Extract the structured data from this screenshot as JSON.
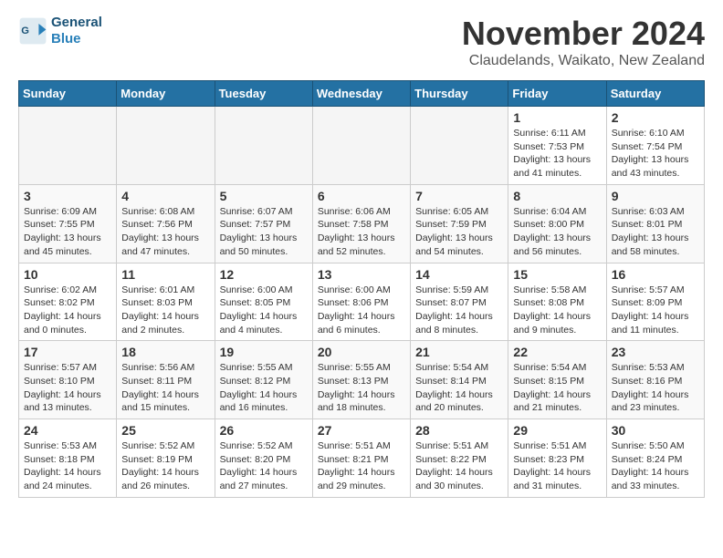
{
  "header": {
    "logo_line1": "General",
    "logo_line2": "Blue",
    "month": "November 2024",
    "location": "Claudelands, Waikato, New Zealand"
  },
  "weekdays": [
    "Sunday",
    "Monday",
    "Tuesday",
    "Wednesday",
    "Thursday",
    "Friday",
    "Saturday"
  ],
  "weeks": [
    [
      {
        "day": "",
        "info": ""
      },
      {
        "day": "",
        "info": ""
      },
      {
        "day": "",
        "info": ""
      },
      {
        "day": "",
        "info": ""
      },
      {
        "day": "",
        "info": ""
      },
      {
        "day": "1",
        "info": "Sunrise: 6:11 AM\nSunset: 7:53 PM\nDaylight: 13 hours\nand 41 minutes."
      },
      {
        "day": "2",
        "info": "Sunrise: 6:10 AM\nSunset: 7:54 PM\nDaylight: 13 hours\nand 43 minutes."
      }
    ],
    [
      {
        "day": "3",
        "info": "Sunrise: 6:09 AM\nSunset: 7:55 PM\nDaylight: 13 hours\nand 45 minutes."
      },
      {
        "day": "4",
        "info": "Sunrise: 6:08 AM\nSunset: 7:56 PM\nDaylight: 13 hours\nand 47 minutes."
      },
      {
        "day": "5",
        "info": "Sunrise: 6:07 AM\nSunset: 7:57 PM\nDaylight: 13 hours\nand 50 minutes."
      },
      {
        "day": "6",
        "info": "Sunrise: 6:06 AM\nSunset: 7:58 PM\nDaylight: 13 hours\nand 52 minutes."
      },
      {
        "day": "7",
        "info": "Sunrise: 6:05 AM\nSunset: 7:59 PM\nDaylight: 13 hours\nand 54 minutes."
      },
      {
        "day": "8",
        "info": "Sunrise: 6:04 AM\nSunset: 8:00 PM\nDaylight: 13 hours\nand 56 minutes."
      },
      {
        "day": "9",
        "info": "Sunrise: 6:03 AM\nSunset: 8:01 PM\nDaylight: 13 hours\nand 58 minutes."
      }
    ],
    [
      {
        "day": "10",
        "info": "Sunrise: 6:02 AM\nSunset: 8:02 PM\nDaylight: 14 hours\nand 0 minutes."
      },
      {
        "day": "11",
        "info": "Sunrise: 6:01 AM\nSunset: 8:03 PM\nDaylight: 14 hours\nand 2 minutes."
      },
      {
        "day": "12",
        "info": "Sunrise: 6:00 AM\nSunset: 8:05 PM\nDaylight: 14 hours\nand 4 minutes."
      },
      {
        "day": "13",
        "info": "Sunrise: 6:00 AM\nSunset: 8:06 PM\nDaylight: 14 hours\nand 6 minutes."
      },
      {
        "day": "14",
        "info": "Sunrise: 5:59 AM\nSunset: 8:07 PM\nDaylight: 14 hours\nand 8 minutes."
      },
      {
        "day": "15",
        "info": "Sunrise: 5:58 AM\nSunset: 8:08 PM\nDaylight: 14 hours\nand 9 minutes."
      },
      {
        "day": "16",
        "info": "Sunrise: 5:57 AM\nSunset: 8:09 PM\nDaylight: 14 hours\nand 11 minutes."
      }
    ],
    [
      {
        "day": "17",
        "info": "Sunrise: 5:57 AM\nSunset: 8:10 PM\nDaylight: 14 hours\nand 13 minutes."
      },
      {
        "day": "18",
        "info": "Sunrise: 5:56 AM\nSunset: 8:11 PM\nDaylight: 14 hours\nand 15 minutes."
      },
      {
        "day": "19",
        "info": "Sunrise: 5:55 AM\nSunset: 8:12 PM\nDaylight: 14 hours\nand 16 minutes."
      },
      {
        "day": "20",
        "info": "Sunrise: 5:55 AM\nSunset: 8:13 PM\nDaylight: 14 hours\nand 18 minutes."
      },
      {
        "day": "21",
        "info": "Sunrise: 5:54 AM\nSunset: 8:14 PM\nDaylight: 14 hours\nand 20 minutes."
      },
      {
        "day": "22",
        "info": "Sunrise: 5:54 AM\nSunset: 8:15 PM\nDaylight: 14 hours\nand 21 minutes."
      },
      {
        "day": "23",
        "info": "Sunrise: 5:53 AM\nSunset: 8:16 PM\nDaylight: 14 hours\nand 23 minutes."
      }
    ],
    [
      {
        "day": "24",
        "info": "Sunrise: 5:53 AM\nSunset: 8:18 PM\nDaylight: 14 hours\nand 24 minutes."
      },
      {
        "day": "25",
        "info": "Sunrise: 5:52 AM\nSunset: 8:19 PM\nDaylight: 14 hours\nand 26 minutes."
      },
      {
        "day": "26",
        "info": "Sunrise: 5:52 AM\nSunset: 8:20 PM\nDaylight: 14 hours\nand 27 minutes."
      },
      {
        "day": "27",
        "info": "Sunrise: 5:51 AM\nSunset: 8:21 PM\nDaylight: 14 hours\nand 29 minutes."
      },
      {
        "day": "28",
        "info": "Sunrise: 5:51 AM\nSunset: 8:22 PM\nDaylight: 14 hours\nand 30 minutes."
      },
      {
        "day": "29",
        "info": "Sunrise: 5:51 AM\nSunset: 8:23 PM\nDaylight: 14 hours\nand 31 minutes."
      },
      {
        "day": "30",
        "info": "Sunrise: 5:50 AM\nSunset: 8:24 PM\nDaylight: 14 hours\nand 33 minutes."
      }
    ]
  ]
}
